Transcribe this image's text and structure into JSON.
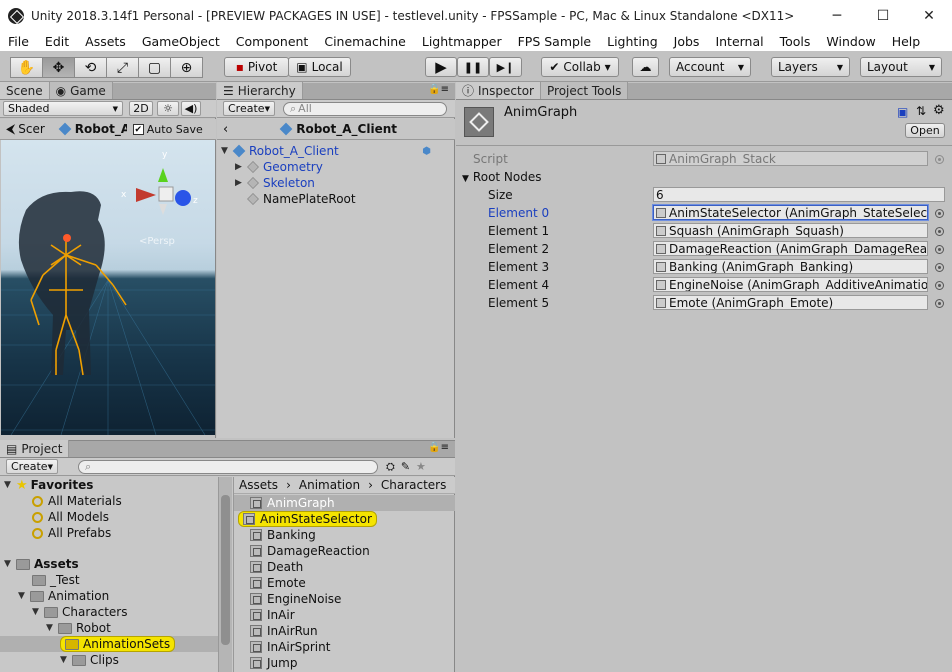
{
  "window": {
    "title": "Unity 2018.3.14f1 Personal - [PREVIEW PACKAGES IN USE] - testlevel.unity - FPSSample - PC, Mac & Linux Standalone <DX11>",
    "minimize": "─",
    "maximize": "☐",
    "close": "✕"
  },
  "menu": [
    "File",
    "Edit",
    "Assets",
    "GameObject",
    "Component",
    "Cinemachine",
    "Lightmapper",
    "FPS Sample",
    "Lighting",
    "Jobs",
    "Internal",
    "Tools",
    "Window",
    "Help"
  ],
  "toolbar": {
    "tools": [
      "✋",
      "✥",
      "⟲",
      "⤢",
      "▢",
      "⊕"
    ],
    "pivot": "Pivot",
    "local": "Local",
    "play": "▶",
    "pause": "❚❚",
    "step": "▶❙",
    "collab": "Collab ▾",
    "account": "Account",
    "layers": "Layers",
    "layout": "Layout"
  },
  "scene": {
    "tab_scene": "Scene",
    "tab_game": "Game",
    "shading": "Shaded",
    "mode2d": "2D",
    "scene_tab_short": "Scer",
    "object_name": "Robot_A",
    "autosave": "Auto Save",
    "persp": "<Persp",
    "axis_x": "x",
    "axis_y": "y",
    "axis_z": "z"
  },
  "hierarchy": {
    "tab": "Hierarchy",
    "create": "Create",
    "search_placeholder": "All",
    "breadcrumb": "Robot_A_Client",
    "items": [
      {
        "label": "Robot_A_Client"
      },
      {
        "label": "Geometry"
      },
      {
        "label": "Skeleton"
      },
      {
        "label": "NamePlateRoot"
      }
    ]
  },
  "inspector": {
    "tab": "Inspector",
    "tab2": "Project Tools",
    "component_title": "AnimGraph",
    "open_button": "Open",
    "script_label": "Script",
    "script_value": "AnimGraph_Stack",
    "root_nodes_label": "Root Nodes",
    "size_label": "Size",
    "size_value": "6",
    "elements": [
      {
        "label": "Element 0",
        "value": "AnimStateSelector (AnimGraph_StateSelecto"
      },
      {
        "label": "Element 1",
        "value": "Squash (AnimGraph_Squash)"
      },
      {
        "label": "Element 2",
        "value": "DamageReaction (AnimGraph_DamageReact"
      },
      {
        "label": "Element 3",
        "value": "Banking (AnimGraph_Banking)"
      },
      {
        "label": "Element 4",
        "value": "EngineNoise (AnimGraph_AdditiveAnimation)"
      },
      {
        "label": "Element 5",
        "value": "Emote (AnimGraph_Emote)"
      }
    ]
  },
  "project": {
    "tab": "Project",
    "create": "Create",
    "favorites_label": "Favorites",
    "favorites": [
      "All Materials",
      "All Models",
      "All Prefabs"
    ],
    "assets_label": "Assets",
    "tree": [
      "_Test",
      "Animation",
      "Characters",
      "Robot",
      "AnimationSets",
      "Clips"
    ],
    "breadcrumb": [
      "Assets",
      "Animation",
      "Characters"
    ],
    "files": [
      "AnimGraph",
      "AnimStateSelector",
      "Banking",
      "DamageReaction",
      "Death",
      "Emote",
      "EngineNoise",
      "InAir",
      "InAirRun",
      "InAirSprint",
      "Jump"
    ]
  },
  "colors": {
    "selection": "#f5e400",
    "link_blue": "#1a3fbf",
    "panel_bg": "#c2c2c2"
  }
}
